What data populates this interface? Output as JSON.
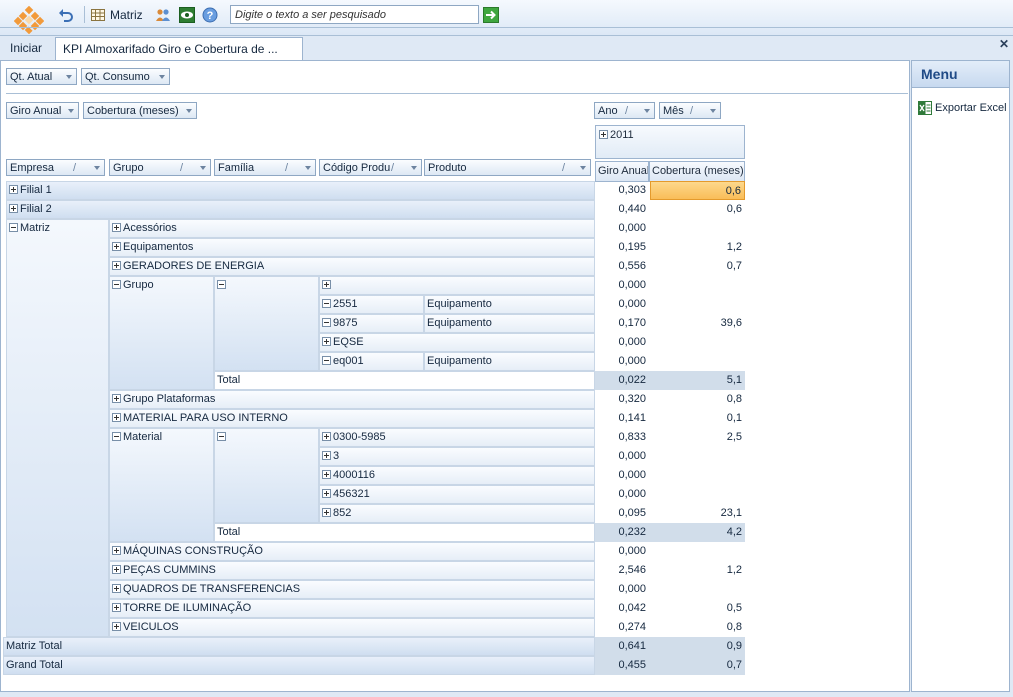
{
  "toolbar": {
    "matriz_label": "Matriz",
    "search_placeholder": "Digite o texto a ser pesquisado"
  },
  "tabs": {
    "home": "Iniciar",
    "active": "KPI Almoxarifado Giro e Cobertura de ..."
  },
  "menu": {
    "title": "Menu",
    "export_excel": "Exportar Excel"
  },
  "filter_fields": [
    "Qt. Atual",
    "Qt. Consumo"
  ],
  "data_fields": [
    "Giro Anual",
    "Cobertura (meses)"
  ],
  "column_fields": [
    "Ano",
    "Mês"
  ],
  "row_fields": [
    "Empresa",
    "Grupo",
    "Família",
    "Código Produ",
    "Produto"
  ],
  "year": "2011",
  "measures": [
    "Giro Anual",
    "Cobertura (meses)"
  ],
  "rows": [
    {
      "giro": "0,303",
      "cob": "0,6"
    },
    {
      "giro": "0,440",
      "cob": "0,6"
    },
    {
      "giro": "0,000",
      "cob": ""
    },
    {
      "giro": "0,195",
      "cob": "1,2"
    },
    {
      "giro": "0,556",
      "cob": "0,7"
    },
    {
      "giro": "0,000",
      "cob": ""
    },
    {
      "giro": "0,000",
      "cob": ""
    },
    {
      "giro": "0,170",
      "cob": "39,6"
    },
    {
      "giro": "0,000",
      "cob": ""
    },
    {
      "giro": "0,000",
      "cob": ""
    },
    {
      "giro": "0,022",
      "cob": "5,1"
    },
    {
      "giro": "0,320",
      "cob": "0,8"
    },
    {
      "giro": "0,141",
      "cob": "0,1"
    },
    {
      "giro": "0,833",
      "cob": "2,5"
    },
    {
      "giro": "0,000",
      "cob": ""
    },
    {
      "giro": "0,000",
      "cob": ""
    },
    {
      "giro": "0,000",
      "cob": ""
    },
    {
      "giro": "0,095",
      "cob": "23,1"
    },
    {
      "giro": "0,232",
      "cob": "4,2"
    },
    {
      "giro": "0,000",
      "cob": ""
    },
    {
      "giro": "2,546",
      "cob": "1,2"
    },
    {
      "giro": "0,000",
      "cob": ""
    },
    {
      "giro": "0,042",
      "cob": "0,5"
    },
    {
      "giro": "0,274",
      "cob": "0,8"
    },
    {
      "giro": "0,641",
      "cob": "0,9"
    },
    {
      "giro": "0,455",
      "cob": "0,7"
    }
  ],
  "labels": {
    "filial1": "Filial 1",
    "filial2": "Filial 2",
    "matriz": "Matriz",
    "acessorios": "Acessórios",
    "equipamentos": "Equipamentos",
    "geradores": "GERADORES DE ENERGIA",
    "grupo": "Grupo",
    "c2551": "2551",
    "c9875": "9875",
    "eqse": "EQSE",
    "eq001": "eq001",
    "produto_equip": "Equipamento",
    "total": "Total",
    "grupo_plataformas": "Grupo Plataformas",
    "material_uso": "MATERIAL PARA USO INTERNO",
    "material": "Material",
    "c0300": "0300-5985",
    "c3": "3",
    "c4000116": "4000116",
    "c456321": "456321",
    "c852": "852",
    "maquinas": "MÁQUINAS CONSTRUÇÃO",
    "pecas": "PEÇAS CUMMINS",
    "quadros": "QUADROS DE TRANSFERENCIAS",
    "torre": "TORRE DE ILUMINAÇÃO",
    "veiculos": "VEICULOS",
    "matriz_total": "Matriz Total",
    "grand_total": "Grand Total"
  },
  "colors": {
    "highlight": "#f9bd58",
    "total_row": "#d1ddea",
    "accent": "#1f4a86"
  }
}
